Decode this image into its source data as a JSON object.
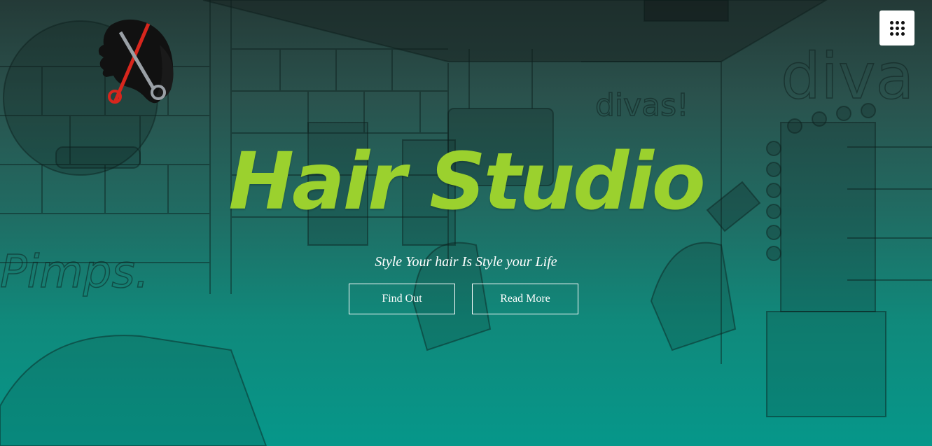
{
  "hero": {
    "title": "Hair Studio",
    "tagline": "Style Your hair Is Style your Life",
    "buttons": {
      "find_out": "Find Out",
      "read_more": "Read More"
    }
  },
  "background": {
    "wall_texts": [
      "divas!",
      "Pimps.",
      "diva"
    ]
  },
  "icons": {
    "logo": "salon-logo-scissors-icon",
    "menu": "grid-menu-icon"
  },
  "colors": {
    "title": "#9bd12e",
    "text": "#ffffff",
    "gradient_top": "#243a37",
    "gradient_bottom": "#06978a",
    "logo_scissors": "#d7261d",
    "menu_background": "#ffffff"
  }
}
